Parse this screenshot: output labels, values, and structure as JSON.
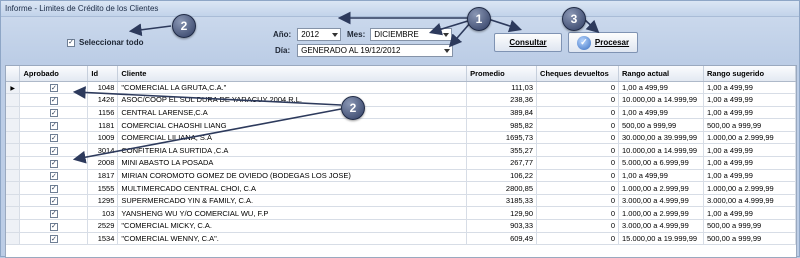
{
  "window": {
    "title": "Informe - Limites de Crédito de los Clientes"
  },
  "filters": {
    "select_all_label": "Seleccionar todo",
    "select_all_checked": true,
    "year_label": "Año:",
    "year_value": "2012",
    "month_label": "Mes:",
    "month_value": "DICIEMBRE",
    "day_label": "Día:",
    "day_value": "GENERADO AL 19/12/2012"
  },
  "buttons": {
    "consultar": "Consultar",
    "procesar": "Procesar"
  },
  "callouts": {
    "one": "1",
    "two": "2",
    "three": "3"
  },
  "grid": {
    "columns": [
      "Aprobado",
      "Id",
      "Cliente",
      "Promedio",
      "Cheques devueltos",
      "Rango actual",
      "Rango sugerido"
    ],
    "rows": [
      {
        "approved": true,
        "id": "1048",
        "client": "\"COMERCIAL LA GRUTA,C.A.\"",
        "avg": "111,03",
        "cheques": "0",
        "current": "1,00 a 499,99",
        "suggested": "1,00 a 499,99"
      },
      {
        "approved": true,
        "id": "1426",
        "client": "ASOC/COOP EL SOL DURA DE YARACUY 2004,R.L.",
        "avg": "238,36",
        "cheques": "0",
        "current": "10.000,00 a 14.999,99",
        "suggested": "1,00 a 499,99"
      },
      {
        "approved": true,
        "id": "1156",
        "client": "CENTRAL LARENSE,C.A",
        "avg": "389,84",
        "cheques": "0",
        "current": "1,00 a 499,99",
        "suggested": "1,00 a 499,99"
      },
      {
        "approved": true,
        "id": "1181",
        "client": "COMERCIAL CHAOSHI LIANG",
        "avg": "985,82",
        "cheques": "0",
        "current": "500,00 a 999,99",
        "suggested": "500,00 a 999,99"
      },
      {
        "approved": true,
        "id": "1009",
        "client": "COMERCIAL LILIANA, S.A",
        "avg": "1695,73",
        "cheques": "0",
        "current": "30.000,00 a 39.999,99",
        "suggested": "1.000,00 a 2.999,99"
      },
      {
        "approved": true,
        "id": "3014",
        "client": "CONFITERIA LA SURTIDA ,C.A",
        "avg": "355,27",
        "cheques": "0",
        "current": "10.000,00 a 14.999,99",
        "suggested": "1,00 a 499,99"
      },
      {
        "approved": true,
        "id": "2008",
        "client": "MINI ABASTO LA POSADA",
        "avg": "267,77",
        "cheques": "0",
        "current": "5.000,00 a 6.999,99",
        "suggested": "1,00 a 499,99"
      },
      {
        "approved": true,
        "id": "1817",
        "client": "MIRIAN COROMOTO GOMEZ DE OVIEDO (BODEGAS LOS JOSE)",
        "avg": "106,22",
        "cheques": "0",
        "current": "1,00 a 499,99",
        "suggested": "1,00 a 499,99"
      },
      {
        "approved": true,
        "id": "1555",
        "client": "MULTIMERCADO CENTRAL CHOI, C.A",
        "avg": "2800,85",
        "cheques": "0",
        "current": "1.000,00 a 2.999,99",
        "suggested": "1.000,00 a 2.999,99"
      },
      {
        "approved": true,
        "id": "1295",
        "client": "SUPERMERCADO YIN & FAMILY, C.A.",
        "avg": "3185,33",
        "cheques": "0",
        "current": "3.000,00 a 4.999,99",
        "suggested": "3.000,00 a 4.999,99"
      },
      {
        "approved": true,
        "id": "103",
        "client": "YANSHENG WU Y/O COMERCIAL WU, F.P",
        "avg": "129,90",
        "cheques": "0",
        "current": "1.000,00 a 2.999,99",
        "suggested": "1,00 a 499,99"
      },
      {
        "approved": true,
        "id": "2529",
        "client": "\"COMERCIAL MICKY, C.A.",
        "avg": "903,33",
        "cheques": "0",
        "current": "3.000,00 a 4.999,99",
        "suggested": "500,00 a 999,99"
      },
      {
        "approved": true,
        "id": "1534",
        "client": "\"COMERCIAL WENNY, C.A\".",
        "avg": "609,49",
        "cheques": "0",
        "current": "15.000,00 a 19.999,99",
        "suggested": "500,00 a 999,99"
      }
    ]
  }
}
